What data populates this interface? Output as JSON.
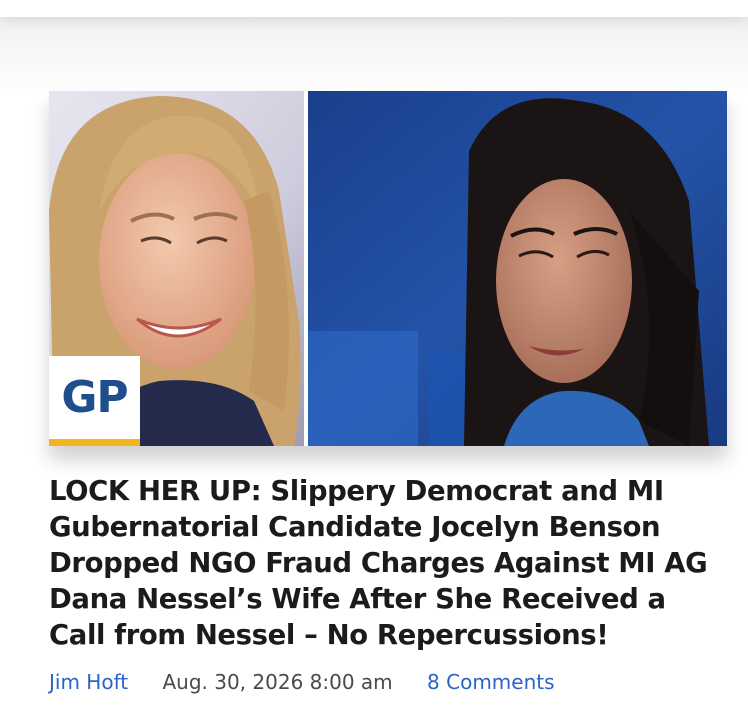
{
  "article": {
    "image": {
      "logo_text": "GP",
      "colors": {
        "logo_blue": "#1e4e8c",
        "logo_gold": "#f2b51e",
        "stage_blue": "#1f4fa0"
      }
    },
    "headline": "LOCK HER UP: Slippery Democrat and MI Gubernatorial Candidate Jocelyn Benson Dropped NGO Fraud Charges Against MI AG Dana Nessel’s Wife After She Received a Call from Nessel – No Repercussions!",
    "meta": {
      "author": "Jim Hoft",
      "date": "Aug. 30, 2026 8:00 am",
      "comments": "8 Comments"
    }
  },
  "colors": {
    "link": "#2c63c9",
    "text": "#1b1b1b",
    "meta_gray": "#4a4a4a"
  }
}
